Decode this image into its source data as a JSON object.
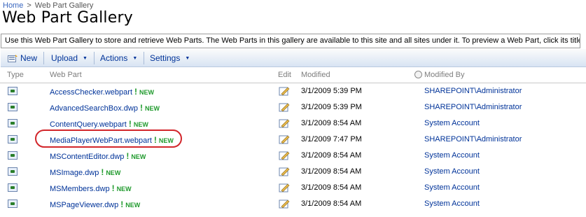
{
  "breadcrumb": {
    "home": "Home",
    "separator": ">",
    "current": "Web Part Gallery"
  },
  "page_title": "Web Part Gallery",
  "description": "Use this Web Part Gallery to store and retrieve Web Parts. The Web Parts in this gallery are available to this site and all sites under it. To preview a Web Part, click its title.",
  "toolbar": {
    "new_label": "New",
    "upload_label": "Upload",
    "actions_label": "Actions",
    "settings_label": "Settings"
  },
  "columns": {
    "type": "Type",
    "web_part": "Web Part",
    "edit": "Edit",
    "modified": "Modified",
    "modified_by": "Modified By"
  },
  "new_badge": "NEW",
  "bang": "!",
  "rows": [
    {
      "name": "AccessChecker.webpart",
      "modified": "3/1/2009 5:39 PM",
      "modified_by": "SHAREPOINT\\Administrator"
    },
    {
      "name": "AdvancedSearchBox.dwp",
      "modified": "3/1/2009 5:39 PM",
      "modified_by": "SHAREPOINT\\Administrator"
    },
    {
      "name": "ContentQuery.webpart",
      "modified": "3/1/2009 8:54 AM",
      "modified_by": "System Account"
    },
    {
      "name": "MediaPlayerWebPart.webpart",
      "modified": "3/1/2009 7:47 PM",
      "modified_by": "SHAREPOINT\\Administrator"
    },
    {
      "name": "MSContentEditor.dwp",
      "modified": "3/1/2009 8:54 AM",
      "modified_by": "System Account"
    },
    {
      "name": "MSImage.dwp",
      "modified": "3/1/2009 8:54 AM",
      "modified_by": "System Account"
    },
    {
      "name": "MSMembers.dwp",
      "modified": "3/1/2009 8:54 AM",
      "modified_by": "System Account"
    },
    {
      "name": "MSPageViewer.dwp",
      "modified": "3/1/2009 8:54 AM",
      "modified_by": "System Account"
    }
  ],
  "colors": {
    "link": "#003399",
    "new_badge": "#1f9a2c",
    "highlight": "#d2262b",
    "toolbar_bottom": "#d8e4f3"
  }
}
